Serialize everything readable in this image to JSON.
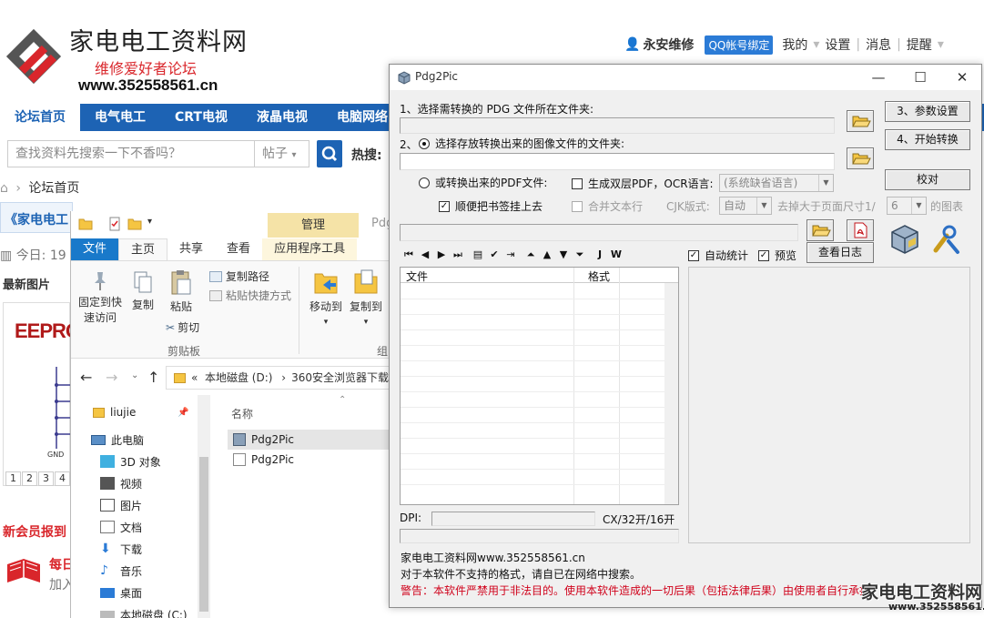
{
  "site": {
    "name": "家电电工资料网",
    "slogan": "维修爱好者论坛",
    "url": "www.352558561.cn",
    "user": "永安维修",
    "qq_bind": "QQ帐号绑定",
    "links": [
      "我的",
      "设置",
      "消息",
      "提醒"
    ],
    "nav": [
      "论坛首页",
      "电气电工",
      "CRT电视",
      "液晶电视",
      "电脑网络"
    ],
    "search_placeholder": "查找资料先搜索一下不香吗？",
    "search_type": "帖子",
    "hot_label": "热搜:",
    "breadcrumb": "论坛首页",
    "forum_link": "《家电电工",
    "today": "今日: 19",
    "latest_images": "最新图片",
    "eepro": "EEPRO",
    "gnd": "GND",
    "pager": [
      "1",
      "2",
      "3",
      "4"
    ],
    "new_member": "新会员报到",
    "daily": "每日",
    "join": "加入",
    "colors": {
      "brand_blue": "#1d63b4",
      "accent_red": "#d9262b"
    }
  },
  "explorer": {
    "manage_tab": "管理",
    "title_hint": "Pdg",
    "ribbon_tabs": [
      "文件",
      "主页",
      "共享",
      "查看",
      "应用程序工具"
    ],
    "ribbon": {
      "pin": "固定到快速访问",
      "copy": "复制",
      "paste": "粘贴",
      "copy_path": "复制路径",
      "paste_shortcut": "粘贴快捷方式",
      "cut": "剪切",
      "clipboard_group": "剪贴板",
      "move_to": "移动到",
      "copy_to": "复制到",
      "organize_group": "组"
    },
    "address": {
      "prefix": "«",
      "drive": "本地磁盘 (D:)",
      "folder": "360安全浏览器下载"
    },
    "tree": [
      "liujie",
      "此电脑",
      "3D 对象",
      "视频",
      "图片",
      "文档",
      "下载",
      "音乐",
      "桌面",
      "本地磁盘 (C:)"
    ],
    "list_header": "名称",
    "files": [
      "Pdg2Pic",
      "Pdg2Pic"
    ]
  },
  "pdg": {
    "title": "Pdg2Pic",
    "step1": "1、选择需转换的 PDG 文件所在文件夹:",
    "step2": "2、",
    "step2_radio": "选择存放转换出来的图像文件的文件夹:",
    "pdf_radio": "或转换出来的PDF文件:",
    "dual_pdf": "生成双层PDF，OCR语言:",
    "ocr_lang": "(系统缺省语言)",
    "bookmark": "顺便把书签挂上去",
    "merge_lines": "合并文本行",
    "cjk_label": "CJK版式:",
    "cjk_value": "自动",
    "remove_label": "去掉大于页面尺寸1/",
    "remove_value": "6",
    "remove_suffix": "的图表",
    "btn_params": "3、参数设置",
    "btn_start": "4、开始转换",
    "btn_proof": "校对",
    "auto_stat": "自动统计",
    "preview": "预览",
    "view_log": "查看日志",
    "col_file": "文件",
    "col_format": "格式",
    "dpi_label": "DPI:",
    "cx_label": "CX/32开/16开",
    "toolbar": [
      "⏮",
      "◀",
      "▶",
      "⏭",
      "▤",
      "✔",
      "⇥",
      "⏶",
      "▲",
      "▼",
      "⏷",
      "J",
      "W"
    ],
    "footer_site": "家电电工资料网www.352558561.cn",
    "footer_hint": "对于本软件不支持的格式，请自已在网络中搜索。",
    "footer_warn": "警告：本软件严禁用于非法目的。使用本软件造成的一切后果（包括法律后果）由使用者自行承担"
  },
  "watermark": {
    "text": "家电电工资料网",
    "url": "www.352558561.cn"
  }
}
